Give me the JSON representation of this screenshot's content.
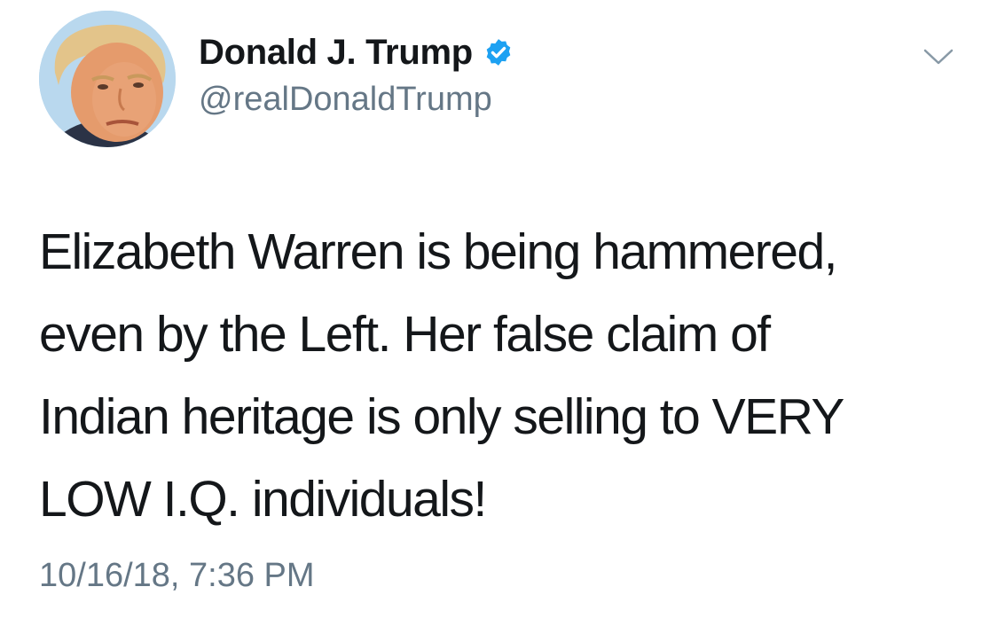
{
  "tweet": {
    "author": {
      "display_name": "Donald J. Trump",
      "handle": "@realDonaldTrump",
      "verified": true,
      "avatar_icon": "profile-photo",
      "verified_icon": "verified-badge-icon"
    },
    "menu_icon": "chevron-down-icon",
    "text_lines": [
      "Elizabeth Warren is being hammered,",
      "even by the Left. Her false claim of",
      "Indian heritage is only selling to VERY",
      "LOW I.Q. individuals!"
    ],
    "timestamp": "10/16/18, 7:36 PM"
  },
  "colors": {
    "text": "#14171a",
    "secondary_text": "#657786",
    "verified_blue": "#1da1f2",
    "background": "#ffffff"
  }
}
